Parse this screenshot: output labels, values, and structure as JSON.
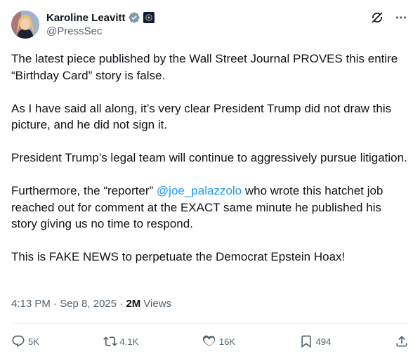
{
  "author": {
    "display_name": "Karoline Leavitt",
    "handle": "@PressSec",
    "verified_badge": "verified-badge-icon",
    "affiliation_badge": "government-affiliation-icon"
  },
  "top_actions": {
    "grok_icon": "grok-icon",
    "more_icon": "more-options-icon"
  },
  "tweet": {
    "paragraph_1": "The latest piece published by the Wall Street Journal PROVES this entire “Birthday Card” story is false.",
    "paragraph_2": "As I have said all along, it’s very clear President Trump did not draw this picture, and he did not sign it.",
    "paragraph_3": "President Trump’s legal team will continue to aggressively pursue litigation.",
    "paragraph_4_before": "Furthermore, the “reporter” ",
    "paragraph_4_mention": "@joe_palazzolo",
    "paragraph_4_after": " who wrote this hatchet job reached out for comment at the EXACT same minute he published his story giving us no time to respond.",
    "paragraph_5": "This is FAKE NEWS to perpetuate the Democrat Epstein Hoax!"
  },
  "meta": {
    "timestamp": "4:13 PM · Sep 8, 2025 · ",
    "views_count": "2M",
    "views_label": "Views"
  },
  "actions": {
    "replies": "5K",
    "reposts": "4.1K",
    "likes": "16K",
    "bookmarks": "494"
  },
  "colors": {
    "text": "#0f1419",
    "secondary": "#536471",
    "link": "#1d9bf0",
    "verified": "#829aab"
  }
}
